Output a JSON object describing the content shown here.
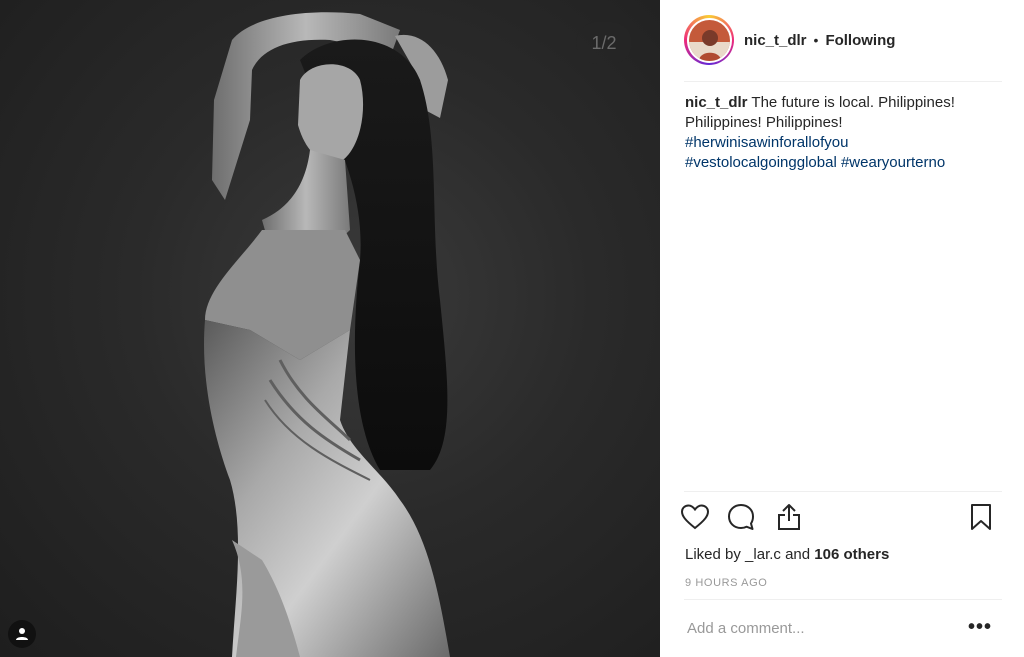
{
  "post": {
    "slide_counter": "1/2",
    "image_alt": "Black and white portrait of a woman in a metallic dress",
    "tag_icon": "person-icon"
  },
  "header": {
    "username": "nic_t_dlr",
    "separator": "•",
    "follow_status": "Following"
  },
  "caption": {
    "username": "nic_t_dlr",
    "text": " The future is local. Philippines! Philippines! Philippines!",
    "hashtags": [
      "#herwinisawinforallofyou",
      "#vestolocalgoingglobal",
      "#wearyourterno"
    ]
  },
  "actions": {
    "like_icon": "heart-icon",
    "comment_icon": "comment-icon",
    "share_icon": "share-icon",
    "save_icon": "bookmark-icon"
  },
  "likes": {
    "prefix": "Liked by",
    "user": "_lar.c",
    "middle": "and",
    "count": "106 others"
  },
  "timestamp": "9 HOURS AGO",
  "comment": {
    "placeholder": "Add a comment...",
    "more_label": "•••"
  },
  "colors": {
    "hashtag": "#003569",
    "text": "#262626",
    "muted": "#999999",
    "divider": "#efefef"
  }
}
